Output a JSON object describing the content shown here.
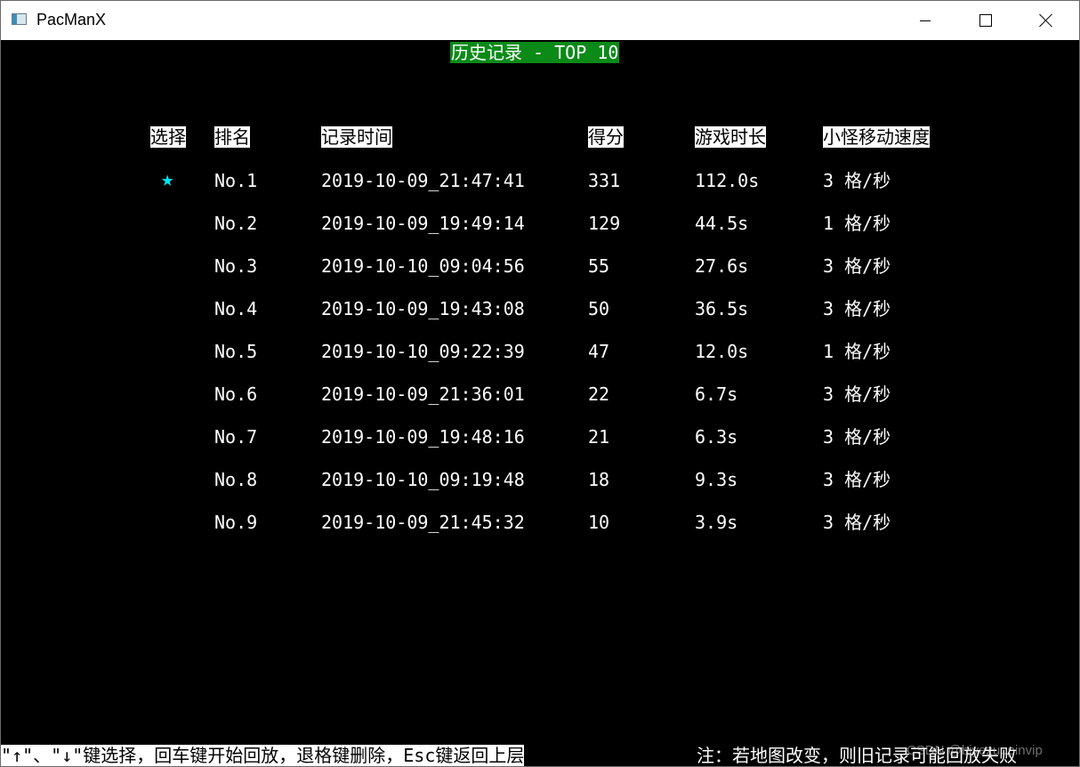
{
  "window": {
    "title": "PacManX",
    "icon": "app-window-icon"
  },
  "header": {
    "title": "历史记录 - TOP 10"
  },
  "columns": [
    "选择",
    "排名",
    "记录时间",
    "得分",
    "游戏时长",
    "小怪移动速度"
  ],
  "selected_marker": "★",
  "rows": [
    {
      "rank": "No.1",
      "time": "2019-10-09_21:47:41",
      "score": "331",
      "duration": "112.0s",
      "speed": "3 格/秒"
    },
    {
      "rank": "No.2",
      "time": "2019-10-09_19:49:14",
      "score": "129",
      "duration": "44.5s",
      "speed": "1 格/秒"
    },
    {
      "rank": "No.3",
      "time": "2019-10-10_09:04:56",
      "score": "55",
      "duration": "27.6s",
      "speed": "3 格/秒"
    },
    {
      "rank": "No.4",
      "time": "2019-10-09_19:43:08",
      "score": "50",
      "duration": "36.5s",
      "speed": "3 格/秒"
    },
    {
      "rank": "No.5",
      "time": "2019-10-10_09:22:39",
      "score": "47",
      "duration": "12.0s",
      "speed": "1 格/秒"
    },
    {
      "rank": "No.6",
      "time": "2019-10-09_21:36:01",
      "score": "22",
      "duration": "6.7s",
      "speed": "3 格/秒"
    },
    {
      "rank": "No.7",
      "time": "2019-10-09_19:48:16",
      "score": "21",
      "duration": "6.3s",
      "speed": "3 格/秒"
    },
    {
      "rank": "No.8",
      "time": "2019-10-10_09:19:48",
      "score": "18",
      "duration": "9.3s",
      "speed": "3 格/秒"
    },
    {
      "rank": "No.9",
      "time": "2019-10-09_21:45:32",
      "score": "10",
      "duration": "3.9s",
      "speed": "3 格/秒"
    }
  ],
  "footer": {
    "help": "\"↑\"、\"↓\"键选择，回车键开始回放，退格键删除，Esc键返回上层",
    "note": "注：若地图改变，则旧记录可能回放失败"
  },
  "watermark": "CSDN @biyezuopinvip",
  "colors": {
    "background": "#000000",
    "title_highlight": "#0b8a18",
    "star": "#00e5f0"
  }
}
